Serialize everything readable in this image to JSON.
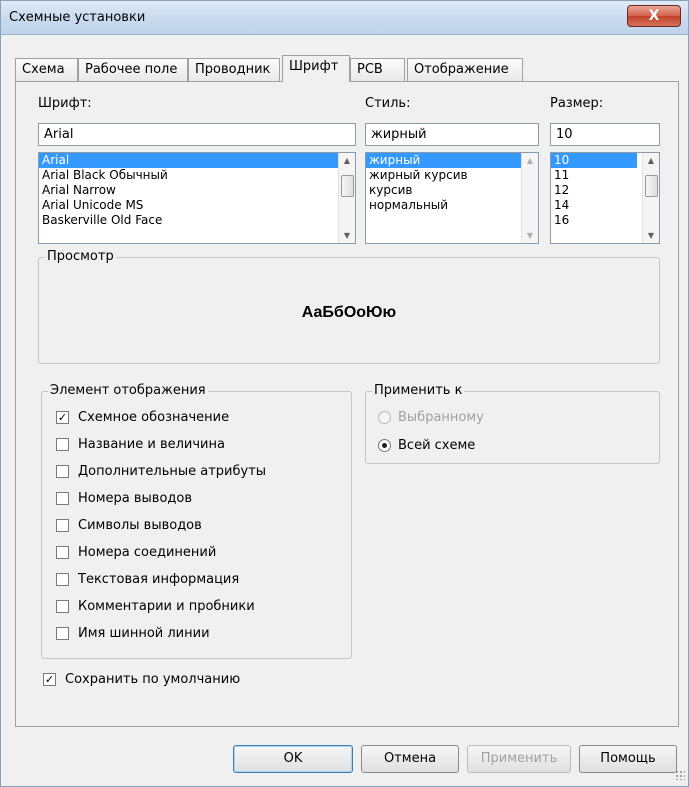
{
  "window": {
    "title": "Схемные установки",
    "close_label": "X"
  },
  "tabs": [
    {
      "label": "Схема",
      "active": false
    },
    {
      "label": "Рабочее поле",
      "active": false
    },
    {
      "label": "Проводник",
      "active": false
    },
    {
      "label": "Шрифт",
      "active": true
    },
    {
      "label": "PCB",
      "active": false
    },
    {
      "label": "Отображение",
      "active": false
    }
  ],
  "font": {
    "label": "Шрифт:",
    "value": "Arial",
    "options": [
      "Arial",
      "Arial Black Обычный",
      "Arial Narrow",
      "Arial Unicode MS",
      "Baskerville Old Face"
    ],
    "selected": "Arial"
  },
  "style": {
    "label": "Стиль:",
    "value": "жирный",
    "options": [
      "жирный",
      "жирный курсив",
      "курсив",
      "нормальный"
    ],
    "selected": "жирный"
  },
  "size": {
    "label": "Размер:",
    "value": "10",
    "options": [
      "10",
      "11",
      "12",
      "14",
      "16"
    ],
    "selected": "10"
  },
  "preview": {
    "title": "Просмотр",
    "sample": "АаБбОоЮю"
  },
  "display_elements": {
    "title": "Элемент отображения",
    "items": [
      {
        "label": "Схемное обозначение",
        "checked": true
      },
      {
        "label": "Название и величина",
        "checked": false
      },
      {
        "label": "Дополнительные атрибуты",
        "checked": false
      },
      {
        "label": "Номера выводов",
        "checked": false
      },
      {
        "label": "Символы выводов",
        "checked": false
      },
      {
        "label": "Номера соединений",
        "checked": false
      },
      {
        "label": "Текстовая информация",
        "checked": false
      },
      {
        "label": "Комментарии и пробники",
        "checked": false
      },
      {
        "label": "Имя шинной линии",
        "checked": false
      }
    ]
  },
  "apply_to": {
    "title": "Применить к",
    "options": [
      {
        "label": "Выбранному",
        "selected": false,
        "disabled": true
      },
      {
        "label": "Всей схеме",
        "selected": true,
        "disabled": false
      }
    ]
  },
  "save_default": {
    "label": "Сохранить по умолчанию",
    "checked": true
  },
  "buttons": {
    "ok": "OK",
    "cancel": "Отмена",
    "apply": "Применить",
    "help": "Помощь"
  },
  "colors": {
    "selection": "#3399ff",
    "dialog_bg": "#f0f0f0",
    "close_button": "#c9493a"
  }
}
